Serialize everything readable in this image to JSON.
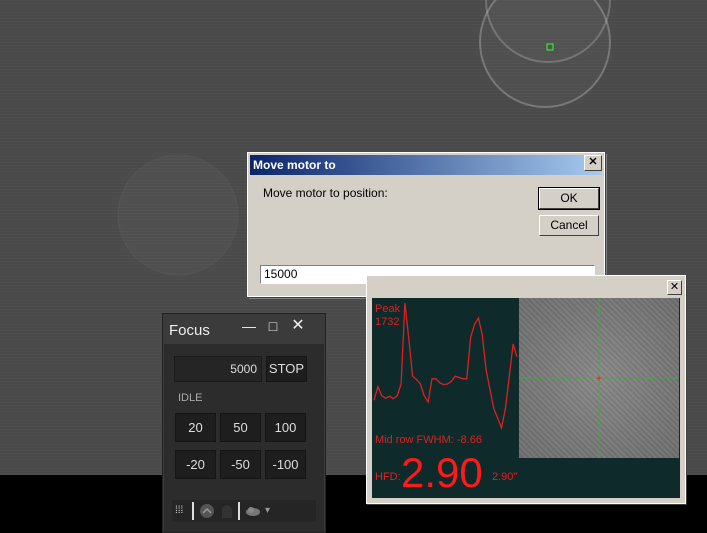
{
  "dialog": {
    "title": "Move motor to",
    "label": "Move motor to position:",
    "ok": "OK",
    "cancel": "Cancel",
    "input_value": "15000",
    "close": "✕"
  },
  "profile": {
    "peak_label": "Peak",
    "peak_value": "1732",
    "fwhm_label": "Mid row FWHM: -8.66",
    "hfd_label": "HFD:",
    "hfd_value": "2.90",
    "hfd_arcsec": "2.90\"",
    "close": "✕",
    "line_values": [
      230,
      440,
      300,
      260,
      290,
      255,
      300,
      480,
      1732,
      1180,
      600,
      550,
      480,
      300,
      200,
      560,
      560,
      500,
      470,
      480,
      520,
      600,
      580,
      560,
      560,
      1200,
      1400,
      1500,
      1250,
      700,
      400,
      100,
      -50,
      -200,
      100,
      600,
      1100,
      900
    ]
  },
  "focus": {
    "title": "Focus",
    "position_value": "5000",
    "stop": "STOP",
    "status": "IDLE",
    "step_buttons": [
      "20",
      "50",
      "100",
      "-20",
      "-50",
      "-100"
    ],
    "min_icon": "—",
    "max_icon": "□",
    "close_icon": "✕",
    "toolbar_icon": "⁞⁞⁞"
  },
  "colors": {
    "title_bar": "#0a246a",
    "profile_line": "#e02020",
    "crosshair": "#20c020",
    "star_box": "#30ff30"
  }
}
